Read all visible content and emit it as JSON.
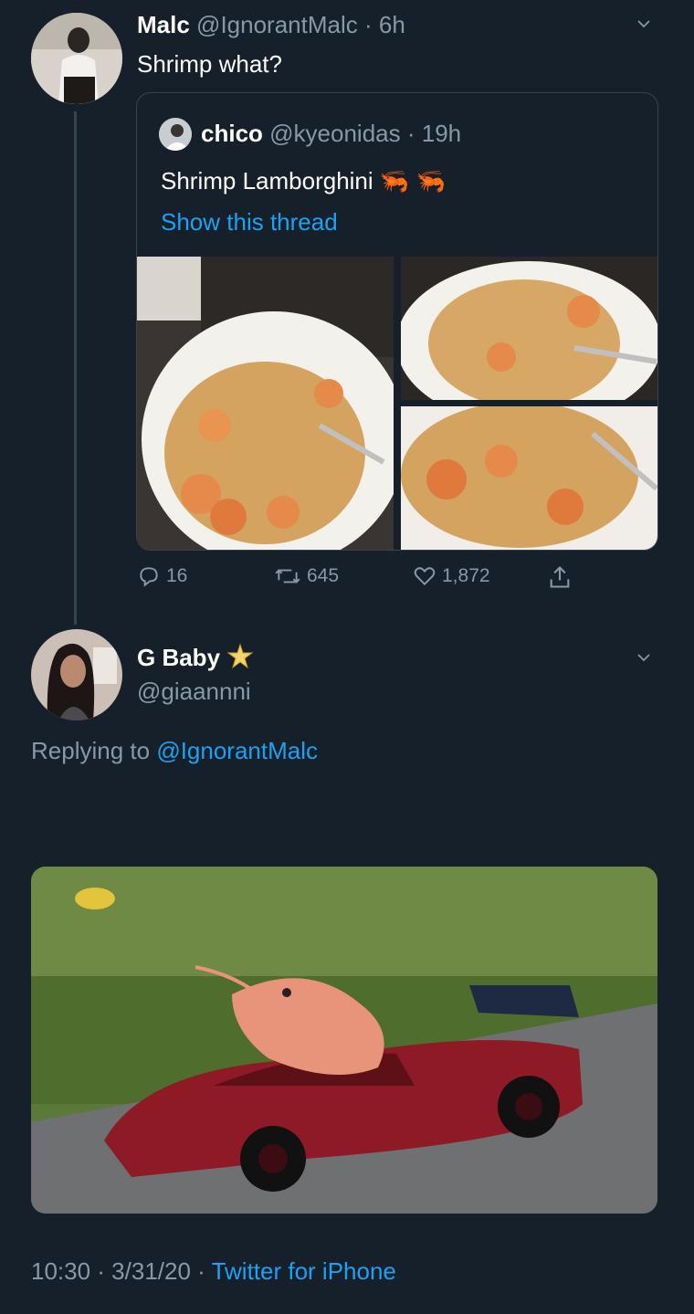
{
  "tweet": {
    "name": "Malc",
    "handle": "@IgnorantMalc",
    "time": "· 6h",
    "text": "Shrimp what?",
    "quote": {
      "name": "chico",
      "handle": "@kyeonidas",
      "time": "· 19h",
      "text": "Shrimp Lamborghini",
      "emoji": "🦐 🦐",
      "show_thread": "Show this thread"
    },
    "actions": {
      "replies": "16",
      "retweets": "645",
      "likes": "1,872"
    }
  },
  "reply": {
    "name": "G Baby",
    "handle": "@giaannni",
    "replying_prefix": "Replying to",
    "replying_to": "@IgnorantMalc",
    "timestamp": "10:30 · 3/31/20 ·",
    "source": "Twitter for iPhone"
  },
  "icons": {
    "reply": "reply-icon",
    "retweet": "retweet-icon",
    "like": "heart-icon",
    "share": "share-icon",
    "more": "chevron-down-icon",
    "badge": "star-badge-icon"
  },
  "colors": {
    "background": "#15202b",
    "accent": "#1da1f2",
    "muted": "#8899a6",
    "border": "#38444d"
  }
}
